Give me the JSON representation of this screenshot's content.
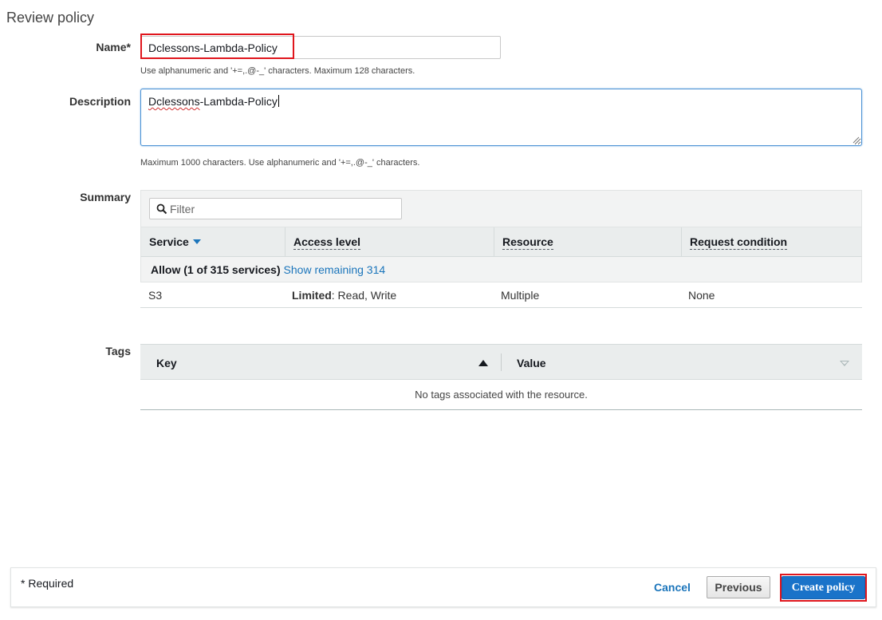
{
  "page": {
    "title": "Review policy"
  },
  "name_field": {
    "label": "Name*",
    "value": "Dclessons-Lambda-Policy",
    "hint": "Use alphanumeric and '+=,.@-_' characters. Maximum 128 characters."
  },
  "description_field": {
    "label": "Description",
    "value_misspelled": "Dclessons",
    "value_rest": "-Lambda-Policy",
    "hint": "Maximum 1000 characters. Use alphanumeric and '+=,.@-_' characters."
  },
  "summary": {
    "label": "Summary",
    "filter_placeholder": "Filter",
    "columns": [
      "Service",
      "Access level",
      "Resource",
      "Request condition"
    ],
    "group": {
      "label": "Allow (1 of 315 services)",
      "link": "Show remaining 314"
    },
    "rows": [
      {
        "service": "S3",
        "access_bold": "Limited",
        "access_rest": ": Read, Write",
        "resource": "Multiple",
        "condition": "None"
      }
    ]
  },
  "tags": {
    "label": "Tags",
    "columns": [
      "Key",
      "Value"
    ],
    "empty_message": "No tags associated with the resource."
  },
  "footer": {
    "required_note": "* Required",
    "cancel": "Cancel",
    "previous": "Previous",
    "create": "Create policy"
  },
  "colors": {
    "accent": "#1b75bb",
    "primary_button": "#1a73c9",
    "highlight": "#e0161d"
  }
}
